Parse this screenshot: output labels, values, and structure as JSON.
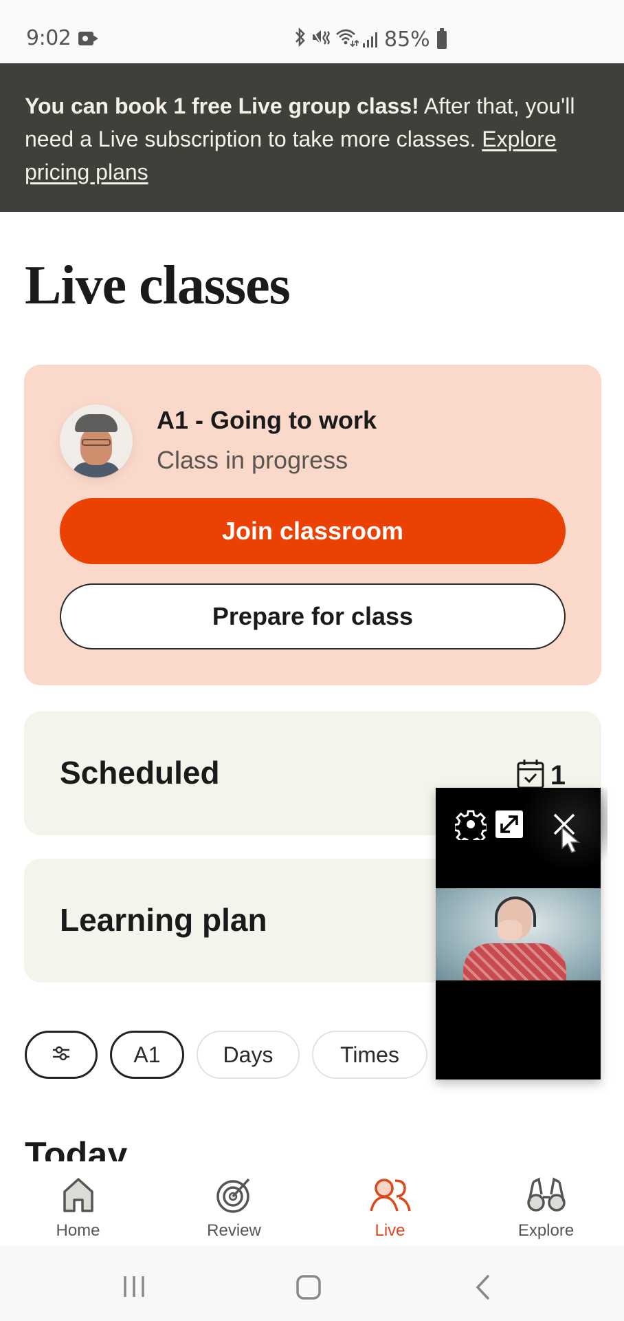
{
  "status_bar": {
    "time": "9:02",
    "battery_percent": "85%",
    "icons": [
      "video-record-icon",
      "bluetooth-icon",
      "mute-vibrate-icon",
      "wifi-icon",
      "signal-icon",
      "battery-icon"
    ]
  },
  "banner": {
    "bold_text": "You can book 1 free Live group class!",
    "text": " After that, you'll need a Live subscription to take more classes. ",
    "link_text": "Explore pricing plans"
  },
  "page": {
    "title": "Live classes"
  },
  "class_card": {
    "title": "A1 - Going to work",
    "status": "Class in progress",
    "join_label": "Join classroom",
    "prepare_label": "Prepare for class"
  },
  "sections": {
    "scheduled": {
      "label": "Scheduled",
      "count": "1"
    },
    "learning_plan": {
      "label": "Learning plan"
    }
  },
  "filters": {
    "chips": [
      {
        "label": "",
        "icon": "filter-sliders-icon",
        "active": true
      },
      {
        "label": "A1",
        "active": true
      },
      {
        "label": "Days",
        "active": false
      },
      {
        "label": "Times",
        "active": false
      }
    ]
  },
  "today_heading": "Today",
  "bottom_nav": {
    "items": [
      {
        "label": "Home",
        "icon": "home-icon",
        "active": false
      },
      {
        "label": "Review",
        "icon": "target-icon",
        "active": false
      },
      {
        "label": "Live",
        "icon": "people-icon",
        "active": true
      },
      {
        "label": "Explore",
        "icon": "binoculars-icon",
        "active": false
      }
    ]
  },
  "pip": {
    "controls": [
      "settings-icon",
      "expand-icon",
      "close-icon"
    ]
  },
  "colors": {
    "accent": "#eb4204",
    "banner_bg": "#40403a",
    "card_bg": "#fad8ca",
    "section_bg": "#f4f3ec",
    "nav_active": "#e0461a"
  }
}
